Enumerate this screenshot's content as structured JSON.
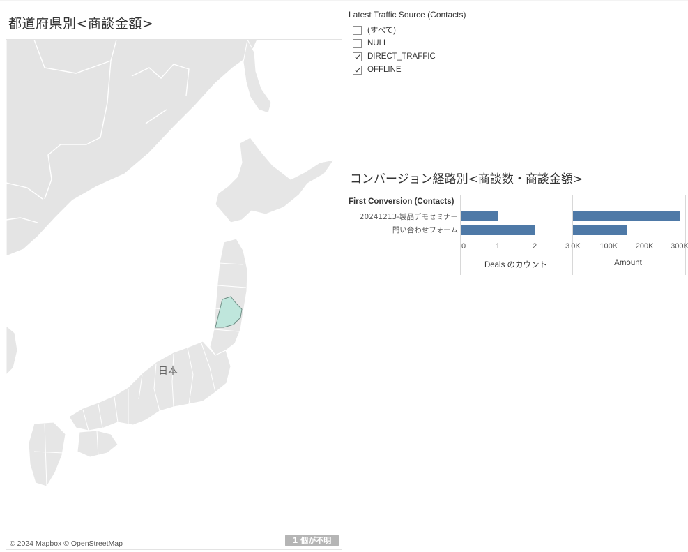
{
  "map": {
    "title": "都道府県別<商談金額>",
    "place_label": "日本",
    "credit": "© 2024 Mapbox © OpenStreetMap",
    "unknown_badge": "1 個が不明",
    "highlight_color": "#bfe6dc"
  },
  "filter": {
    "title": "Latest Traffic Source (Contacts)",
    "items": [
      {
        "label": "(すべて)",
        "checked": false
      },
      {
        "label": "NULL",
        "checked": false
      },
      {
        "label": "DIRECT_TRAFFIC",
        "checked": true
      },
      {
        "label": "OFFLINE",
        "checked": true
      }
    ]
  },
  "chart": {
    "title": "コンバージョン経路別<商談数・商談金額>",
    "dimension_header": "First Conversion (Contacts)",
    "rows": [
      "20241213-製品デモセミナー",
      "問い合わせフォーム"
    ]
  },
  "chart_data": [
    {
      "type": "bar",
      "orientation": "horizontal",
      "categories": [
        "20241213-製品デモセミナー",
        "問い合わせフォーム"
      ],
      "values": [
        1,
        2
      ],
      "xlabel": "Deals のカウント",
      "xlim": [
        0,
        3
      ],
      "ticks": [
        "0",
        "1",
        "2",
        "3"
      ],
      "color": "#4e79a7"
    },
    {
      "type": "bar",
      "orientation": "horizontal",
      "categories": [
        "20241213-製品デモセミナー",
        "問い合わせフォーム"
      ],
      "values": [
        300000,
        150000
      ],
      "xlabel": "Amount",
      "xlim": [
        0,
        310000
      ],
      "ticks": [
        "0K",
        "100K",
        "200K",
        "300K"
      ],
      "color": "#4e79a7"
    }
  ]
}
